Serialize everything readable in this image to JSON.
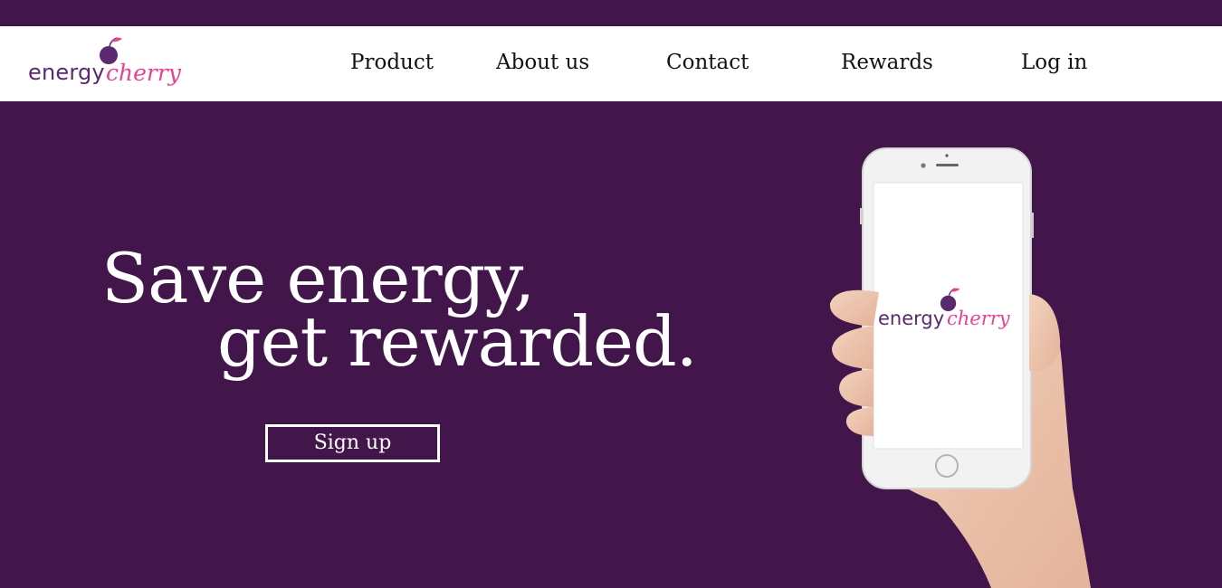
{
  "brand": {
    "part1": "energy",
    "part2": "cherry"
  },
  "nav": {
    "items": [
      {
        "label": "Product"
      },
      {
        "label": "About us"
      },
      {
        "label": "Contact"
      },
      {
        "label": "Rewards"
      },
      {
        "label": "Log in"
      }
    ]
  },
  "hero": {
    "line1": "Save energy,",
    "line2": "get rewarded.",
    "cta": "Sign up"
  },
  "colors": {
    "background": "#42164a",
    "brand_purple": "#5b2a6e",
    "brand_pink": "#e8438f"
  },
  "icons": [
    "cherry-logo-icon",
    "smartphone-image",
    "hand-image"
  ]
}
